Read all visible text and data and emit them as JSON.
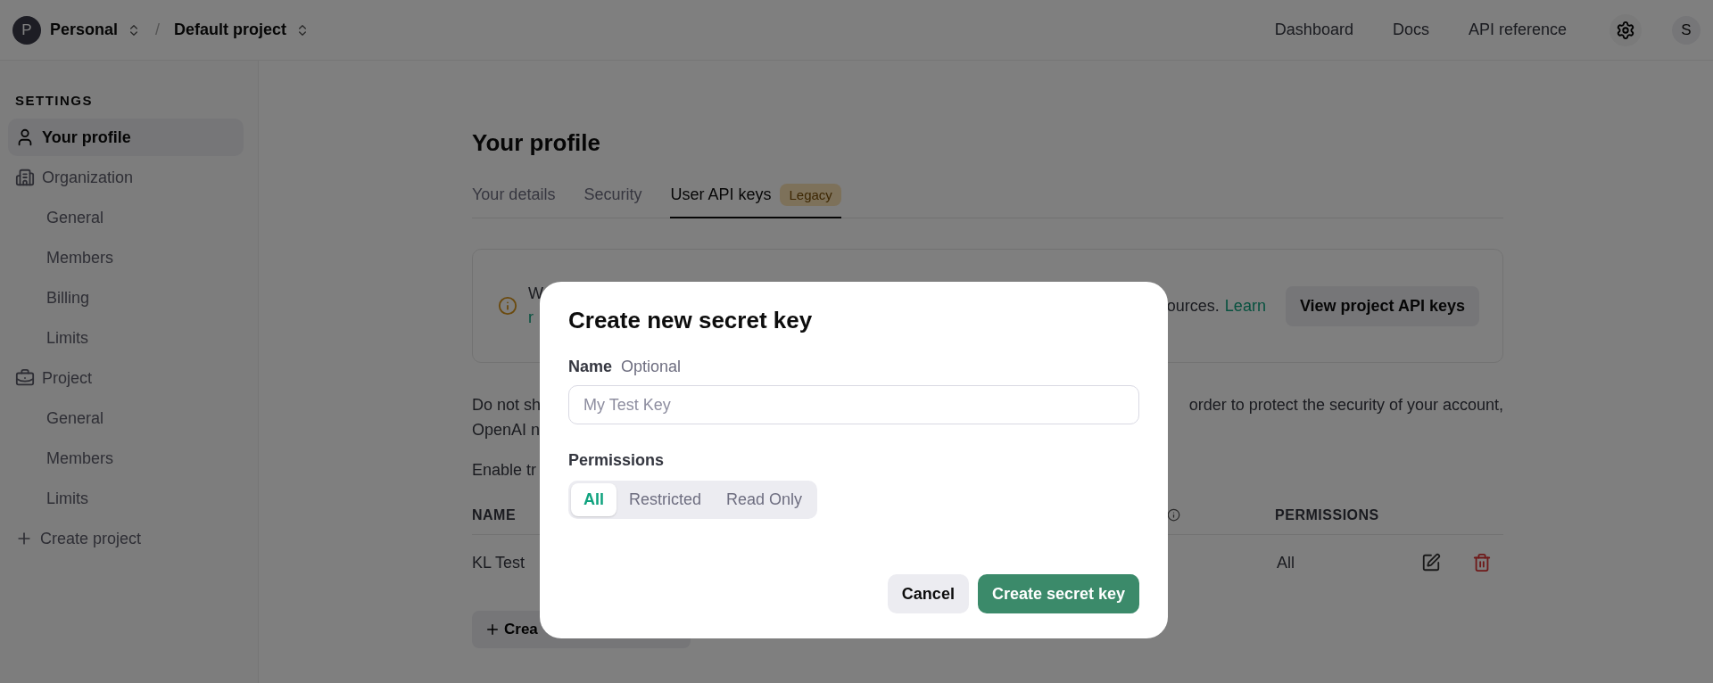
{
  "topbar": {
    "org_avatar": "P",
    "org": "Personal",
    "separator": "/",
    "project": "Default project",
    "links": [
      {
        "label": "Dashboard"
      },
      {
        "label": "Docs"
      },
      {
        "label": "API reference"
      }
    ],
    "user_avatar": "S"
  },
  "sidebar": {
    "heading": "SETTINGS",
    "items": [
      {
        "kind": "profile",
        "label": "Your profile",
        "selected": true
      },
      {
        "kind": "organization",
        "label": "Organization",
        "selected": false,
        "children": [
          {
            "label": "General",
            "selected": false
          },
          {
            "label": "Members",
            "selected": false
          },
          {
            "label": "Billing",
            "selected": false
          },
          {
            "label": "Limits",
            "selected": false
          }
        ]
      },
      {
        "kind": "project",
        "label": "Project",
        "selected": false,
        "children": [
          {
            "label": "General",
            "selected": false
          },
          {
            "label": "Members",
            "selected": false
          },
          {
            "label": "Limits",
            "selected": false
          }
        ]
      },
      {
        "kind": "create",
        "label": "Create project",
        "selected": false
      }
    ]
  },
  "page": {
    "title": "Your profile",
    "tabs": [
      {
        "label": "Your details",
        "selected": false
      },
      {
        "label": "Security",
        "selected": false
      },
      {
        "label": "User API keys",
        "selected": true,
        "badge": "Legacy"
      }
    ],
    "notice": {
      "left_lines": [
        "W",
        "r"
      ],
      "right_text": "ources.",
      "link": "Learn",
      "button": "View project API keys"
    },
    "paragraph": [
      {
        "left": "Do not sh",
        "right": "order to protect the security of your account,"
      },
      {
        "left": "OpenAI n"
      }
    ],
    "enable_text": "Enable tr",
    "table": {
      "columns": [
        {
          "label": "NAME"
        },
        {
          "label": "PERMISSIONS"
        }
      ],
      "rows": [
        {
          "name": "KL Test",
          "permissions": "All"
        }
      ]
    },
    "create_button": "Crea"
  },
  "modal": {
    "title": "Create new secret key",
    "name_label": "Name",
    "name_hint": "Optional",
    "name_placeholder": "My Test Key",
    "permissions_label": "Permissions",
    "permissions": [
      {
        "label": "All",
        "selected": true
      },
      {
        "label": "Restricted",
        "selected": false
      },
      {
        "label": "Read Only",
        "selected": false
      }
    ],
    "buttons": [
      {
        "kind": "secondary",
        "label": "Cancel"
      },
      {
        "kind": "primary",
        "label": "Create secret key"
      }
    ]
  }
}
